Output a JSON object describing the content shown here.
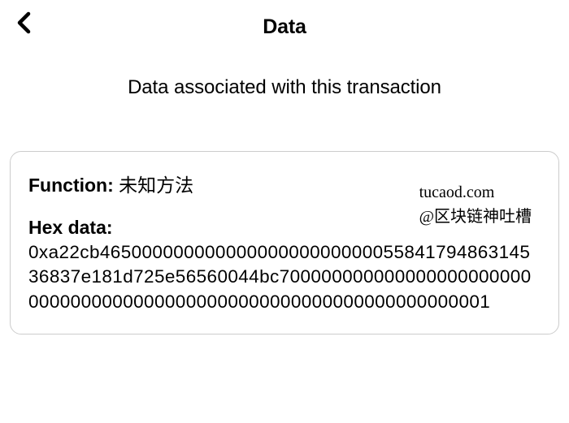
{
  "header": {
    "title": "Data"
  },
  "subtitle": "Data associated with this transaction",
  "card": {
    "function_label": "Function:",
    "function_value": "未知方法",
    "hex_label": "Hex data:",
    "hex_value": "0xa22cb4650000000000000000000000005584179486314536837e181d725e56560044bc70000000000000000000000000000000000000000000000000000000000000000001"
  },
  "watermark": {
    "line1": "tucaod.com",
    "line2": "@区块链神吐槽"
  }
}
